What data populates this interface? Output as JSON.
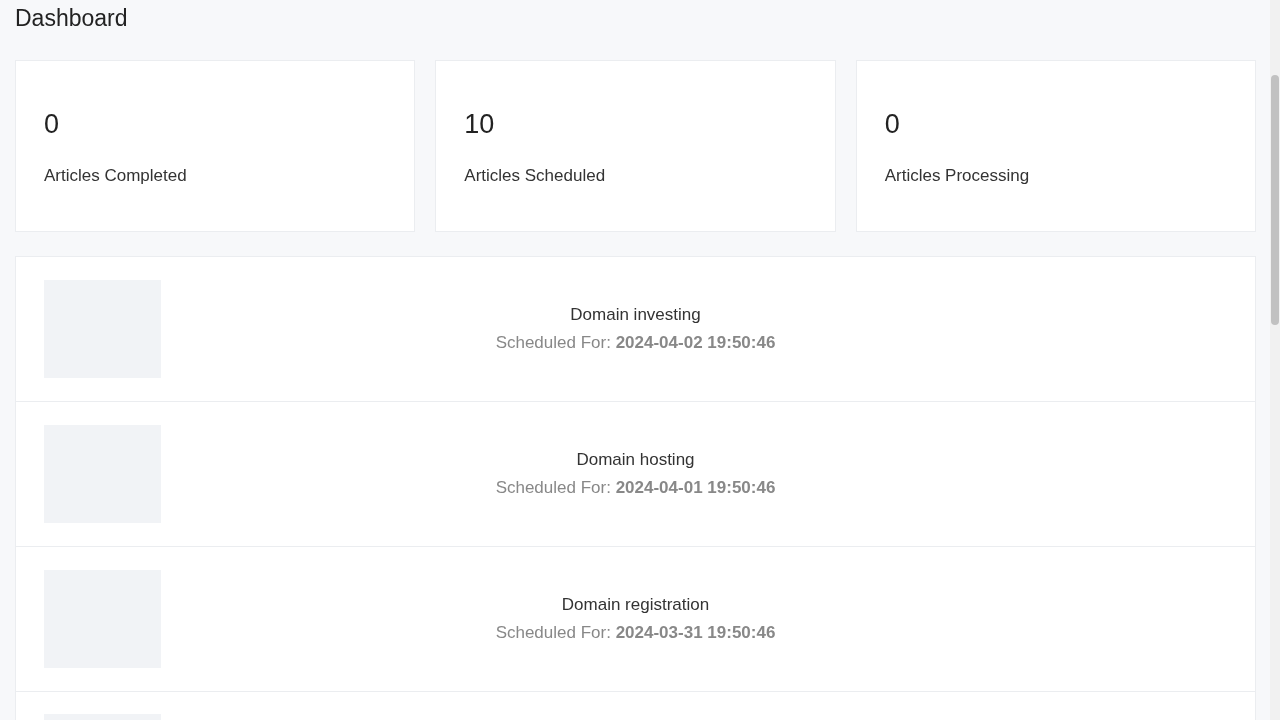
{
  "page": {
    "title": "Dashboard"
  },
  "stats": [
    {
      "value": "0",
      "label": "Articles Completed"
    },
    {
      "value": "10",
      "label": "Articles Scheduled"
    },
    {
      "value": "0",
      "label": "Articles Processing"
    }
  ],
  "articles": [
    {
      "title": "Domain investing",
      "schedule": "Scheduled For: **2024-04-02 19:50:46**"
    },
    {
      "title": "Domain hosting",
      "schedule": "Scheduled For: **2024-04-01 19:50:46**"
    },
    {
      "title": "Domain registration",
      "schedule": "Scheduled For: **2024-03-31 19:50:46**"
    }
  ]
}
